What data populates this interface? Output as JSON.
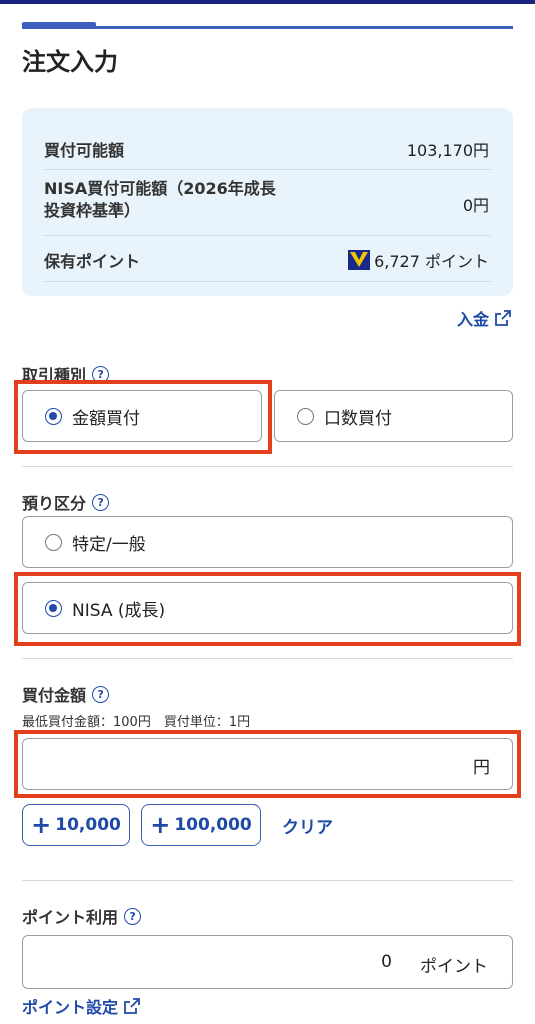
{
  "header": {
    "title": "注文入力"
  },
  "balances": {
    "buy_available": {
      "label": "買付可能額",
      "value": "103,170円"
    },
    "nisa_available": {
      "label": "NISA買付可能額（2026年成長投資枠基準）",
      "value": "0円"
    },
    "points": {
      "label": "保有ポイント",
      "value": "6,727 ポイント",
      "icon": "v-point-icon"
    }
  },
  "deposit_link": {
    "label": "入金",
    "icon": "external-link-icon"
  },
  "trade_type": {
    "label": "取引種別",
    "options": [
      {
        "label": "金額買付",
        "selected": true
      },
      {
        "label": "口数買付",
        "selected": false
      }
    ]
  },
  "account_type": {
    "label": "預り区分",
    "options": [
      {
        "label": "特定/一般",
        "selected": false
      },
      {
        "label": "NISA (成長)",
        "selected": true
      }
    ]
  },
  "amount": {
    "label": "買付金額",
    "note": "最低買付金額：100円　買付単位：1円",
    "value": "",
    "unit": "円",
    "quick_buttons": [
      "10,000",
      "100,000"
    ],
    "clear_label": "クリア"
  },
  "points_use": {
    "label": "ポイント利用",
    "value": "0",
    "unit": "ポイント",
    "setting_link": "ポイント設定"
  },
  "colors": {
    "accent": "#1f4aa8",
    "highlight": "#e2401c",
    "info_bg": "#e8f3fb"
  }
}
